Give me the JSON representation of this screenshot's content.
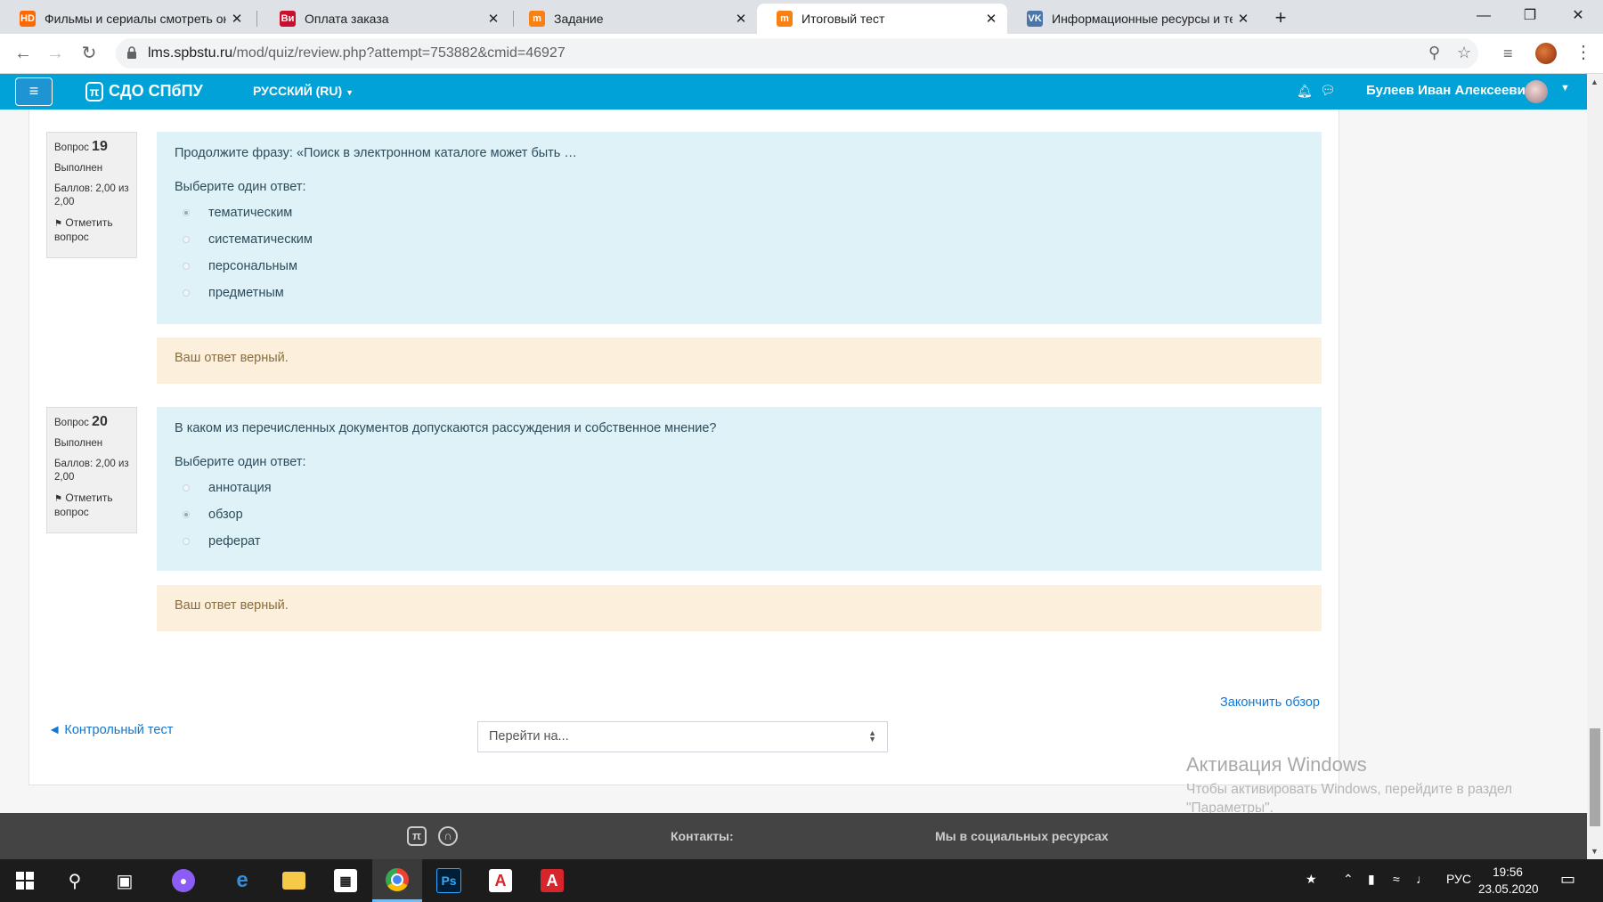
{
  "browser": {
    "tabs": [
      {
        "title": "Фильмы и сериалы смотреть он",
        "fav": "HD",
        "fav_color": "#ff6a00",
        "active": false
      },
      {
        "title": "Оплата заказа",
        "fav": "Ви",
        "fav_color": "#c8102e",
        "active": false
      },
      {
        "title": "Задание",
        "fav": "m",
        "fav_color": "#f98012",
        "active": false
      },
      {
        "title": "Итоговый тест",
        "fav": "m",
        "fav_color": "#f98012",
        "active": true
      },
      {
        "title": "Информационные ресурсы и те",
        "fav": "VK",
        "fav_color": "#4a76a8",
        "active": false
      }
    ],
    "new_tab": "+",
    "url_host": "lms.spbstu.ru",
    "url_path": "/mod/quiz/review.php?attempt=753882&cmid=46927"
  },
  "navbar": {
    "brand": "СДО СПбПУ",
    "logo_glyph": "π",
    "language": "РУССКИЙ (RU)",
    "user_name": "Булеев Иван Алексеевич"
  },
  "questions": [
    {
      "label": "Вопрос",
      "number": "19",
      "state": "Выполнен",
      "grade": "Баллов: 2,00 из 2,00",
      "flag": "Отметить вопрос",
      "text": "Продолжите фразу: «Поиск в электронном каталоге может быть …",
      "prompt": "Выберите один ответ:",
      "options": [
        "тематическим",
        "систематическим",
        "персональным",
        "предметным"
      ],
      "selected_index": 0,
      "feedback": "Ваш ответ верный."
    },
    {
      "label": "Вопрос",
      "number": "20",
      "state": "Выполнен",
      "grade": "Баллов: 2,00 из 2,00",
      "flag": "Отметить вопрос",
      "text": "В каком из перечисленных документов допускаются рассуждения и собственное мнение?",
      "prompt": "Выберите один ответ:",
      "options": [
        "аннотация",
        "обзор",
        "реферат"
      ],
      "selected_index": 1,
      "feedback": "Ваш ответ верный."
    }
  ],
  "nav": {
    "finish_review": "Закончить обзор",
    "prev_activity": "◄ Контрольный тест",
    "jump_placeholder": "Перейти на..."
  },
  "watermark": {
    "title": "Активация Windows",
    "line1": "Чтобы активировать Windows, перейдите в раздел",
    "line2": "\"Параметры\"."
  },
  "footer": {
    "contacts": "Контакты:",
    "social": "Мы в социальных ресурсах"
  },
  "taskbar": {
    "language": "РУС",
    "time": "19:56",
    "date": "23.05.2020"
  },
  "colors": {
    "navbar": "#00a2d8",
    "question_bg": "#def2f8",
    "feedback_bg": "#fcefdc",
    "link": "#1177d1"
  }
}
